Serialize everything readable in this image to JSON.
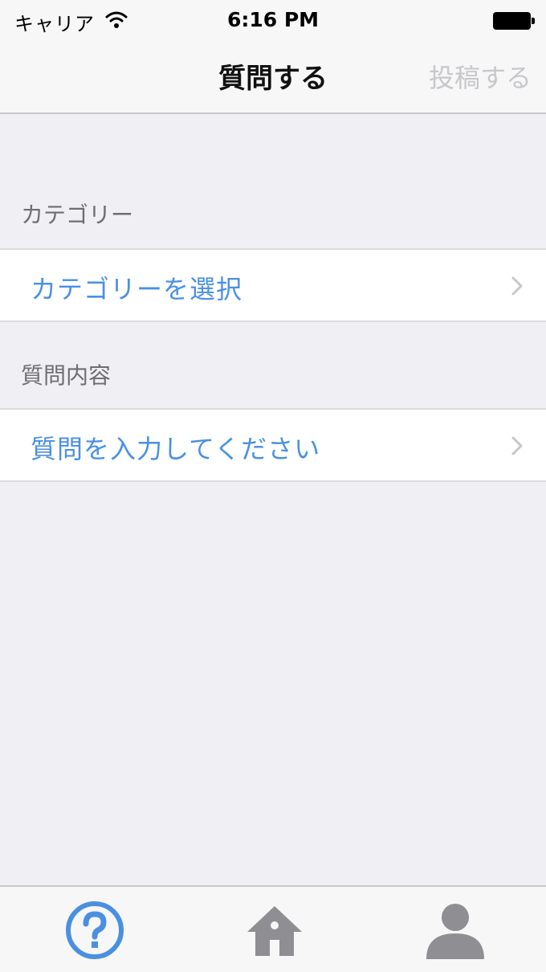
{
  "status_bar": {
    "carrier": "キャリア",
    "time": "6:16 PM",
    "icons": [
      "wifi-icon",
      "battery-icon"
    ]
  },
  "nav": {
    "title": "質問する",
    "post_label": "投稿する"
  },
  "sections": {
    "category_header": "カテゴリー",
    "category_cell": "カテゴリーを選択",
    "content_header": "質問内容",
    "content_cell": "質問を入力してください"
  },
  "tab_bar": {
    "tabs": [
      {
        "icon": "question-icon",
        "active": true
      },
      {
        "icon": "home-icon",
        "active": false
      },
      {
        "icon": "person-icon",
        "active": false
      }
    ]
  },
  "colors": {
    "accent": "#4a90e2",
    "background": "#efeff4",
    "inactive_icon": "#8e8e93",
    "disabled_text": "#c7c7cc"
  }
}
